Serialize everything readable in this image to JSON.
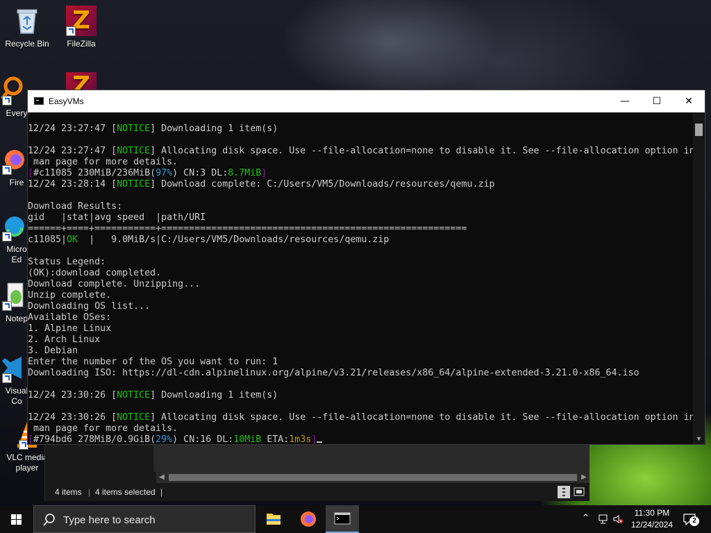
{
  "desktop": {
    "icons": [
      {
        "id": "recycle-bin",
        "label": "Recycle Bin"
      },
      {
        "id": "filezilla",
        "label": "FileZilla"
      },
      {
        "id": "everything",
        "label": "Every"
      },
      {
        "id": "filezilla-2",
        "label": ""
      },
      {
        "id": "firefox",
        "label": "Fire"
      },
      {
        "id": "edge",
        "label": "Micro\nEd"
      },
      {
        "id": "notepad",
        "label": "Notep"
      },
      {
        "id": "vscode",
        "label": "Visual\nCo"
      },
      {
        "id": "vlc",
        "label": "VLC media\nplayer"
      }
    ]
  },
  "terminal": {
    "title": "EasyVMs",
    "lines": [
      [
        {
          "t": "12/24 23:27:47 ["
        },
        {
          "t": "NOTICE",
          "c": "g"
        },
        {
          "t": "] Downloading 1 item(s)"
        }
      ],
      [],
      [
        {
          "t": "12/24 23:27:47 ["
        },
        {
          "t": "NOTICE",
          "c": "g"
        },
        {
          "t": "] Allocating disk space. Use --file-allocation=none to disable it. See --file-allocation option in"
        }
      ],
      [
        {
          "t": " man page for more details."
        }
      ],
      [
        {
          "t": "[",
          "c": "m"
        },
        {
          "t": "#c11085 230MiB/236MiB("
        },
        {
          "t": "97%",
          "c": "c"
        },
        {
          "t": ") CN:3 DL:"
        },
        {
          "t": "8.7MiB",
          "c": "g"
        },
        {
          "t": "]",
          "c": "m"
        }
      ],
      [
        {
          "t": "12/24 23:28:14 ["
        },
        {
          "t": "NOTICE",
          "c": "g"
        },
        {
          "t": "] Download complete: C:/Users/VM5/Downloads/resources/qemu.zip"
        }
      ],
      [],
      [
        {
          "t": "Download Results:"
        }
      ],
      [
        {
          "t": "gid   |stat|avg speed  |path/URI"
        }
      ],
      [
        {
          "t": "======+====+===========+======================================================="
        }
      ],
      [
        {
          "t": "c11085|"
        },
        {
          "t": "OK",
          "c": "g"
        },
        {
          "t": "  |   9.0MiB/s|C:/Users/VM5/Downloads/resources/qemu.zip"
        }
      ],
      [],
      [
        {
          "t": "Status Legend:"
        }
      ],
      [
        {
          "t": "(OK):download completed."
        }
      ],
      [
        {
          "t": "Download complete. Unzipping..."
        }
      ],
      [
        {
          "t": "Unzip complete."
        }
      ],
      [
        {
          "t": "Downloading OS list..."
        }
      ],
      [
        {
          "t": "Available OSes:"
        }
      ],
      [
        {
          "t": "1. Alpine Linux"
        }
      ],
      [
        {
          "t": "2. Arch Linux"
        }
      ],
      [
        {
          "t": "3. Debian"
        }
      ],
      [
        {
          "t": "Enter the number of the OS you want to run: 1"
        }
      ],
      [
        {
          "t": "Downloading ISO: https://dl-cdn.alpinelinux.org/alpine/v3.21/releases/x86_64/alpine-extended-3.21.0-x86_64.iso"
        }
      ],
      [],
      [
        {
          "t": "12/24 23:30:26 ["
        },
        {
          "t": "NOTICE",
          "c": "g"
        },
        {
          "t": "] Downloading 1 item(s)"
        }
      ],
      [],
      [
        {
          "t": "12/24 23:30:26 ["
        },
        {
          "t": "NOTICE",
          "c": "g"
        },
        {
          "t": "] Allocating disk space. Use --file-allocation=none to disable it. See --file-allocation option in"
        }
      ],
      [
        {
          "t": " man page for more details."
        }
      ],
      [
        {
          "t": "[",
          "c": "m"
        },
        {
          "t": "#794bd6 278MiB/0.9GiB("
        },
        {
          "t": "29%",
          "c": "c"
        },
        {
          "t": ") CN:16 DL:"
        },
        {
          "t": "10MiB",
          "c": "g"
        },
        {
          "t": " ETA:"
        },
        {
          "t": "1m3s",
          "c": "y"
        },
        {
          "t": "]",
          "c": "m"
        }
      ]
    ]
  },
  "explorer": {
    "status_items": "4 items",
    "status_selected": "4 items selected"
  },
  "taskbar": {
    "search_placeholder": "Type here to search",
    "apps": [
      "file-explorer",
      "firefox",
      "terminal"
    ],
    "clock_time": "11:30 PM",
    "clock_date": "12/24/2024",
    "notification_count": "2"
  },
  "colors": {
    "notice_green": "#16c60c",
    "percent_cyan": "#3a96dd",
    "eta_yellow": "#c19c00",
    "bracket_magenta": "#881798",
    "taskbar_bg": "#101010"
  }
}
